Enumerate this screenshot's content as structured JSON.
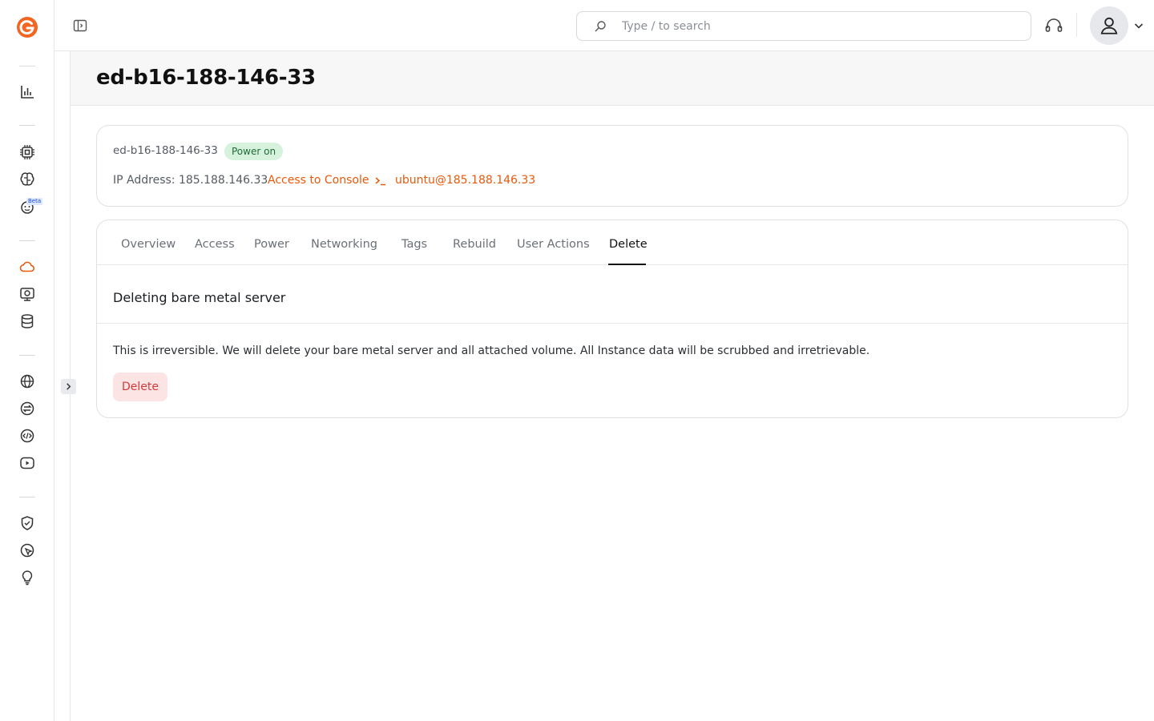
{
  "app": {
    "logo": "gcore-logo",
    "accent_color": "#e8590c",
    "beta_label": "Beta"
  },
  "sidebar": {
    "items": [
      {
        "icon": "bar-chart-icon"
      },
      {
        "icon": "chip-icon"
      },
      {
        "icon": "brain-icon"
      },
      {
        "icon": "robot-icon",
        "badge": "Beta"
      },
      {
        "icon": "cloud-icon",
        "active": true
      },
      {
        "icon": "monitor-icon"
      },
      {
        "icon": "database-icon"
      },
      {
        "icon": "globe-icon"
      },
      {
        "icon": "exchange-icon"
      },
      {
        "icon": "code-icon"
      },
      {
        "icon": "video-icon"
      },
      {
        "icon": "shield-icon"
      },
      {
        "icon": "cursor-shield-icon"
      },
      {
        "icon": "lightbulb-icon"
      }
    ]
  },
  "header": {
    "search_placeholder": "Type / to search"
  },
  "page": {
    "title": "ed-b16-188-146-33"
  },
  "server": {
    "name": "ed-b16-188-146-33",
    "status": "Power on",
    "ip_label": "IP Address: 185.188.146.33",
    "console_link": "Access to Console",
    "ssh_link": "ubuntu@185.188.146.33"
  },
  "tabs": [
    {
      "label": "Overview"
    },
    {
      "label": "Access"
    },
    {
      "label": "Power"
    },
    {
      "label": "Networking"
    },
    {
      "label": "Tags"
    },
    {
      "label": "Rebuild"
    },
    {
      "label": "User Actions"
    },
    {
      "label": "Delete",
      "active": true
    }
  ],
  "delete_section": {
    "title": "Deleting bare metal server",
    "description": "This is irreversible. We will delete your bare metal server and all attached volume. All Instance data will be scrubbed and irretrievable.",
    "button_label": "Delete"
  }
}
